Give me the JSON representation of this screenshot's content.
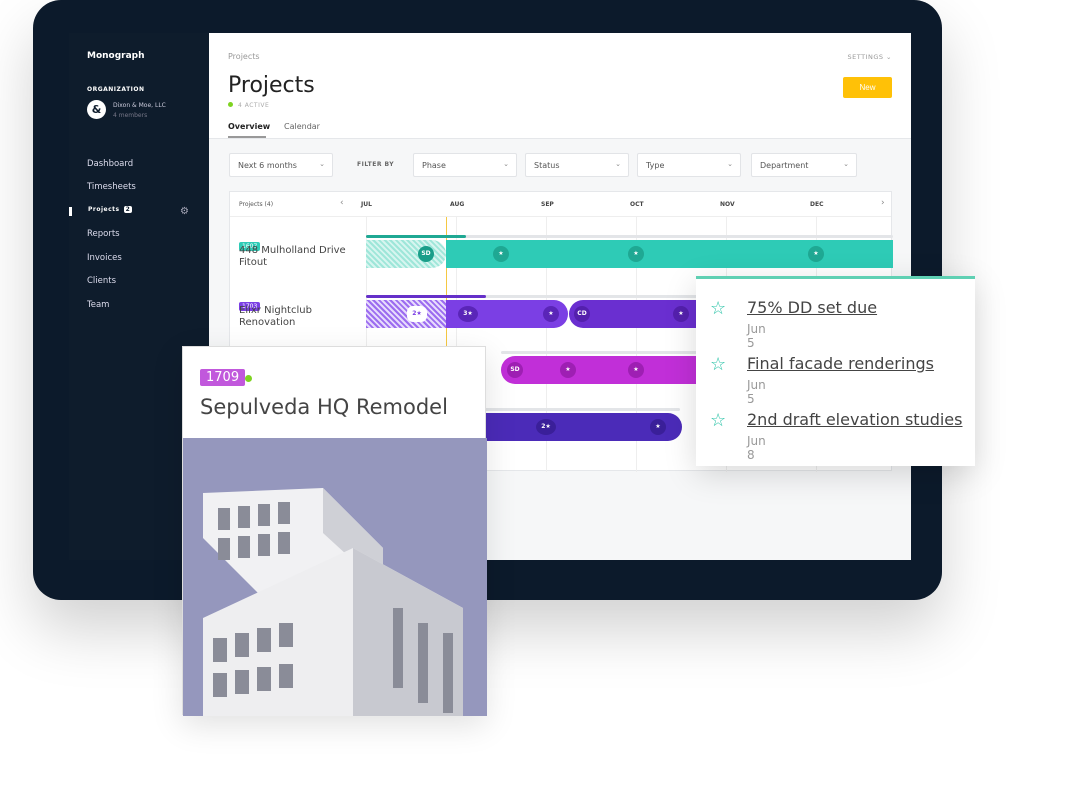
{
  "sidebar": {
    "brand": "Monograph",
    "org_heading": "ORGANIZATION",
    "org_avatar": "&",
    "org_name": "Dixon & Moe, LLC",
    "org_members": "4 members",
    "items": [
      {
        "label": "Dashboard"
      },
      {
        "label": "Timesheets"
      },
      {
        "label": "Projects",
        "badge": "2"
      },
      {
        "label": "Reports"
      },
      {
        "label": "Invoices"
      },
      {
        "label": "Clients"
      },
      {
        "label": "Team"
      }
    ]
  },
  "header": {
    "breadcrumb": "Projects",
    "title": "Projects",
    "active_count": "4 ACTIVE",
    "settings": "SETTINGS ⌄",
    "new_button": "New",
    "tabs": [
      "Overview",
      "Calendar"
    ]
  },
  "filters": {
    "range": "Next 6 months",
    "filter_by": "FILTER BY",
    "phase": "Phase",
    "status": "Status",
    "type": "Type",
    "department": "Department"
  },
  "gantt": {
    "header": "Projects (4)",
    "months": [
      "JUL",
      "AUG",
      "SEP",
      "OCT",
      "NOV",
      "DEC"
    ],
    "rows": [
      {
        "id": "1607",
        "name": "448 Mulholland Drive Fitout",
        "color": "#2ecbb6"
      },
      {
        "id": "1703",
        "name": "Elixr Nightclub Renovation",
        "color": "#7b3fe4"
      }
    ],
    "milestones": {
      "sd": "SD",
      "cd": "CD",
      "two": "2★",
      "three": "3★",
      "star": "★"
    }
  },
  "card": {
    "id": "1709",
    "name": "Sepulveda HQ Remodel",
    "accent": "#c158dc"
  },
  "tooltip": {
    "items": [
      {
        "label": "75% DD set due",
        "date": "Jun 5"
      },
      {
        "label": "Final facade renderings",
        "date": "Jun 5"
      },
      {
        "label": "2nd draft elevation studies",
        "date": "Jun 8"
      }
    ]
  }
}
